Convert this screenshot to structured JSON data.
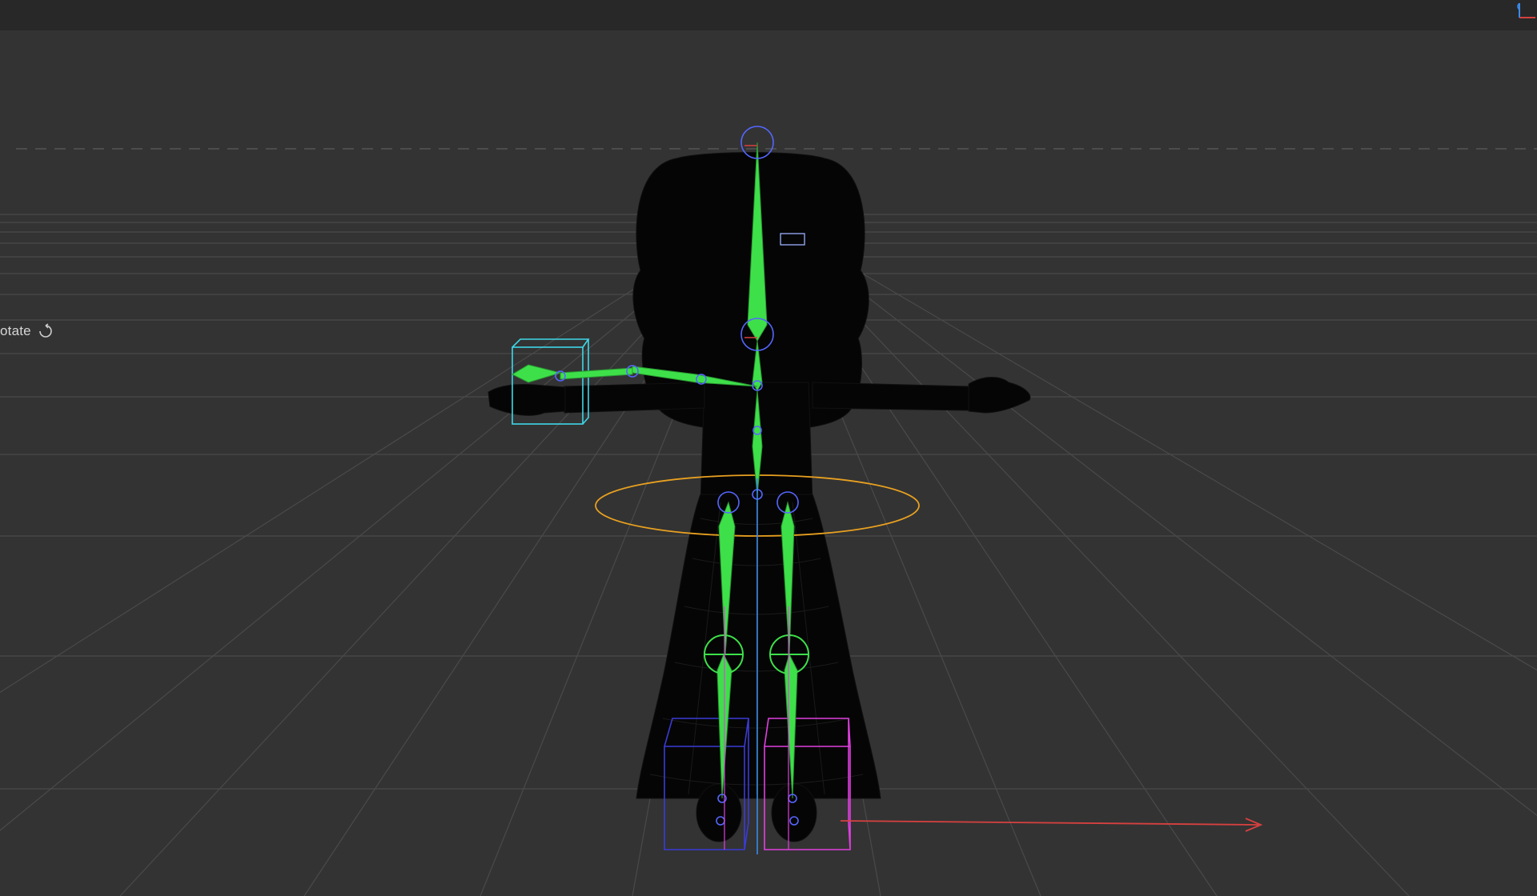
{
  "toolbar": {
    "mode_label": "otate"
  },
  "icons": {
    "rotate": "rotate-icon",
    "axis_gizmo": "axis-gizmo-icon"
  },
  "colors": {
    "viewport_bg": "#333333",
    "grid_line": "#4a4a4a",
    "bone": "#3ee04a",
    "joint": "#5566ff",
    "selection_box": "#3fd7e8",
    "foot_ctrl_left": "#3b3bd6",
    "foot_ctrl_right": "#e040e0",
    "hip_ctrl": "#e8a020",
    "x_axis": "#d84040",
    "y_axis": "#3a8ae8"
  }
}
